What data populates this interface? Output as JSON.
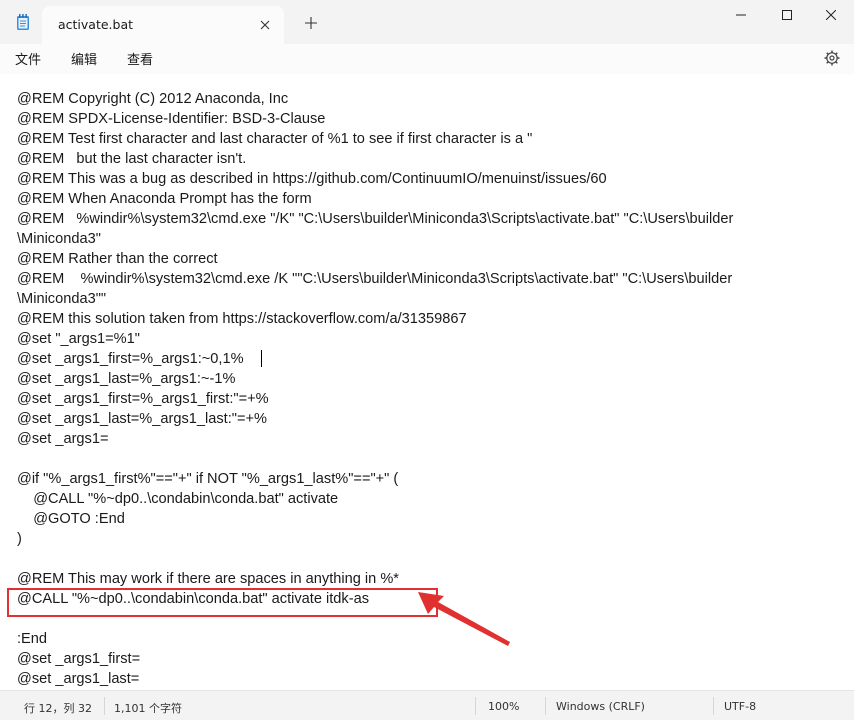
{
  "tab": {
    "title": "activate.bat"
  },
  "menu": {
    "file": "文件",
    "edit": "编辑",
    "view": "查看"
  },
  "code_lines": [
    "@REM Copyright (C) 2012 Anaconda, Inc",
    "@REM SPDX-License-Identifier: BSD-3-Clause",
    "@REM Test first character and last character of %1 to see if first character is a \"",
    "@REM   but the last character isn't.",
    "@REM This was a bug as described in https://github.com/ContinuumIO/menuinst/issues/60",
    "@REM When Anaconda Prompt has the form",
    "@REM   %windir%\\system32\\cmd.exe \"/K\" \"C:\\Users\\builder\\Miniconda3\\Scripts\\activate.bat\" \"C:\\Users\\builder",
    "\\Miniconda3\"",
    "@REM Rather than the correct",
    "@REM    %windir%\\system32\\cmd.exe /K \"\"C:\\Users\\builder\\Miniconda3\\Scripts\\activate.bat\" \"C:\\Users\\builder",
    "\\Miniconda3\"\"",
    "@REM this solution taken from https://stackoverflow.com/a/31359867",
    "@set \"_args1=%1\"",
    "@set _args1_first=%_args1:~0,1%",
    "@set _args1_last=%_args1:~-1%",
    "@set _args1_first=%_args1_first:\"=+%",
    "@set _args1_last=%_args1_last:\"=+%",
    "@set _args1=",
    "",
    "@if \"%_args1_first%\"==\"+\" if NOT \"%_args1_last%\"==\"+\" (",
    "    @CALL \"%~dp0..\\condabin\\conda.bat\" activate",
    "    @GOTO :End",
    ")",
    "",
    "@REM This may work if there are spaces in anything in %*",
    "@CALL \"%~dp0..\\condabin\\conda.bat\" activate itdk-as",
    "",
    ":End",
    "@set _args1_first=",
    "@set _args1_last="
  ],
  "status": {
    "position": "行 12，列 32",
    "chars": "1,101 个字符",
    "zoom": "100%",
    "line_ending": "Windows (CRLF)",
    "encoding": "UTF-8"
  },
  "colors": {
    "annotation": "#e03030"
  }
}
